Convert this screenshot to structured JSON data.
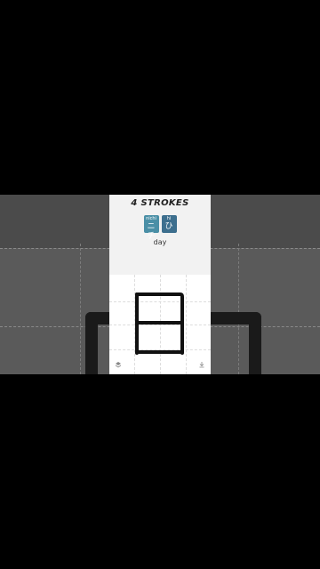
{
  "card": {
    "title": "4 STROKES",
    "readings": [
      {
        "type": "on",
        "romaji": "nichi",
        "kana": "ニチ",
        "color": "#4a8fa6"
      },
      {
        "type": "kun",
        "romaji": "hi",
        "kana": "ひ",
        "color": "#3d6f8e"
      }
    ],
    "meaning": "day"
  },
  "toolbar": {
    "layers_icon": "layers-icon",
    "download_icon": "download-icon"
  }
}
